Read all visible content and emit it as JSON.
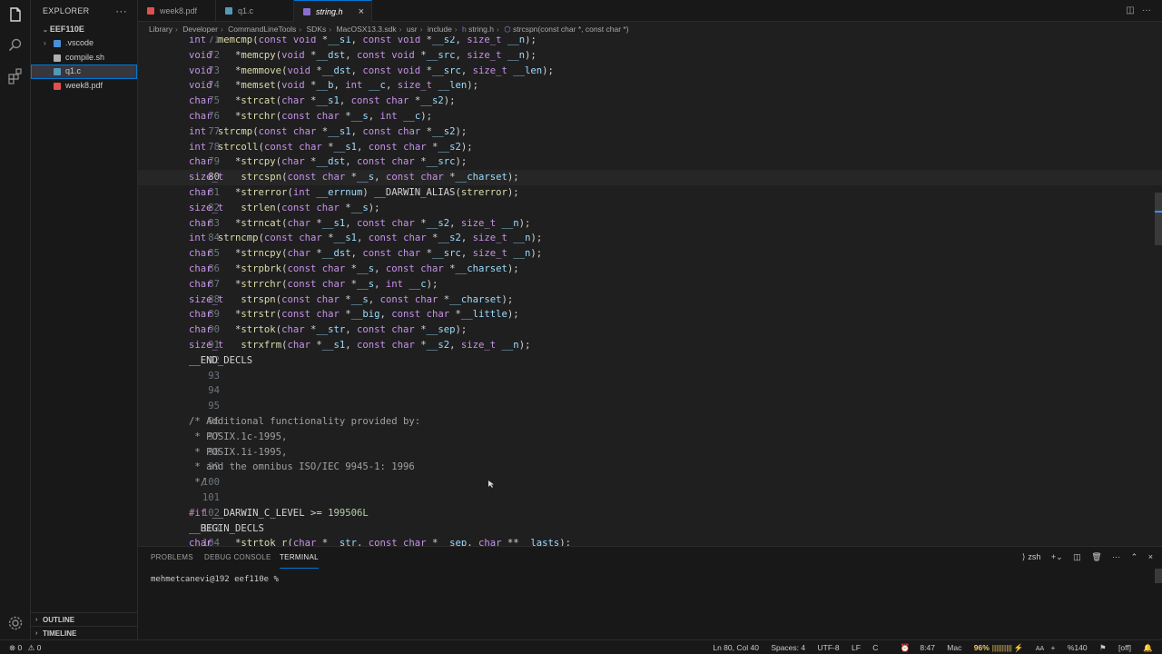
{
  "sidebar": {
    "title": "EXPLORER",
    "folder": "EEF110E",
    "items": [
      {
        "name": ".vscode",
        "color": "#4a90d9",
        "chev": "›"
      },
      {
        "name": "compile.sh",
        "color": "#b0b0b0",
        "chev": ""
      },
      {
        "name": "q1.c",
        "color": "#519aba",
        "chev": ""
      },
      {
        "name": "week8.pdf",
        "color": "#e05050",
        "chev": ""
      }
    ],
    "outline": "OUTLINE",
    "timeline": "TIMELINE"
  },
  "tabs": [
    {
      "label": "week8.pdf",
      "color": "#e05050"
    },
    {
      "label": "q1.c",
      "color": "#519aba"
    },
    {
      "label": "string.h",
      "color": "#8a6fd1"
    }
  ],
  "breadcrumb": [
    "Library",
    "Developer",
    "CommandLineTools",
    "SDKs",
    "MacOSX13.3.sdk",
    "usr",
    "include",
    "string.h",
    "strcspn(const char *, const char *)"
  ],
  "editor": {
    "current_line": 80,
    "lines": [
      {
        "n": "71",
        "t": "int  memcmp(const void *__s1, const void *__s2, size_t __n);"
      },
      {
        "n": "72",
        "t": "void    *memcpy(void *__dst, const void *__src, size_t __n);"
      },
      {
        "n": "73",
        "t": "void    *memmove(void *__dst, const void *__src, size_t __len);"
      },
      {
        "n": "74",
        "t": "void    *memset(void *__b, int __c, size_t __len);"
      },
      {
        "n": "75",
        "t": "char    *strcat(char *__s1, const char *__s2);"
      },
      {
        "n": "76",
        "t": "char    *strchr(const char *__s, int __c);"
      },
      {
        "n": "77",
        "t": "int  strcmp(const char *__s1, const char *__s2);"
      },
      {
        "n": "78",
        "t": "int  strcoll(const char *__s1, const char *__s2);"
      },
      {
        "n": "79",
        "t": "char    *strcpy(char *__dst, const char *__src);"
      },
      {
        "n": "80",
        "t": "size_t   strcspn(const char *__s, const char *__charset);"
      },
      {
        "n": "81",
        "t": "char    *strerror(int __errnum) __DARWIN_ALIAS(strerror);"
      },
      {
        "n": "82",
        "t": "size_t   strlen(const char *__s);"
      },
      {
        "n": "83",
        "t": "char    *strncat(char *__s1, const char *__s2, size_t __n);"
      },
      {
        "n": "84",
        "t": "int  strncmp(const char *__s1, const char *__s2, size_t __n);"
      },
      {
        "n": "85",
        "t": "char    *strncpy(char *__dst, const char *__src, size_t __n);"
      },
      {
        "n": "86",
        "t": "char    *strpbrk(const char *__s, const char *__charset);"
      },
      {
        "n": "87",
        "t": "char    *strrchr(const char *__s, int __c);"
      },
      {
        "n": "88",
        "t": "size_t   strspn(const char *__s, const char *__charset);"
      },
      {
        "n": "89",
        "t": "char    *strstr(const char *__big, const char *__little);"
      },
      {
        "n": "90",
        "t": "char    *strtok(char *__str, const char *__sep);"
      },
      {
        "n": "91",
        "t": "size_t   strxfrm(char *__s1, const char *__s2, size_t __n);"
      },
      {
        "n": "92",
        "t": "__END_DECLS"
      },
      {
        "n": "93",
        "t": ""
      },
      {
        "n": "94",
        "t": ""
      },
      {
        "n": "95",
        "t": ""
      },
      {
        "n": "96",
        "t": "/* Additional functionality provided by:"
      },
      {
        "n": "97",
        "t": " * POSIX.1c-1995,"
      },
      {
        "n": "98",
        "t": " * POSIX.1i-1995,"
      },
      {
        "n": "99",
        "t": " * and the omnibus ISO/IEC 9945-1: 1996"
      },
      {
        "n": "100",
        "t": " */"
      },
      {
        "n": "101",
        "t": ""
      },
      {
        "n": "102",
        "t": "#if __DARWIN_C_LEVEL >= 199506L"
      },
      {
        "n": "103",
        "t": "__BEGIN_DECLS"
      },
      {
        "n": "104",
        "t": "char    *strtok_r(char *__str, const char *__sep, char **__lasts);"
      }
    ]
  },
  "panel": {
    "tabs": [
      "PROBLEMS",
      "DEBUG CONSOLE",
      "TERMINAL"
    ],
    "active_tab": "TERMINAL",
    "prompt": "mehmetcanevi@192 eef110e %",
    "shell": "zsh"
  },
  "status": {
    "errors": "0",
    "warnings": "0",
    "position": "Ln 80, Col 40",
    "spaces": "Spaces: 4",
    "encoding": "UTF-8",
    "eol": "LF",
    "language": "C",
    "time": "8:47",
    "os": "Mac",
    "battery": "96%",
    "zoom": "%140",
    "extra": "[off]"
  }
}
